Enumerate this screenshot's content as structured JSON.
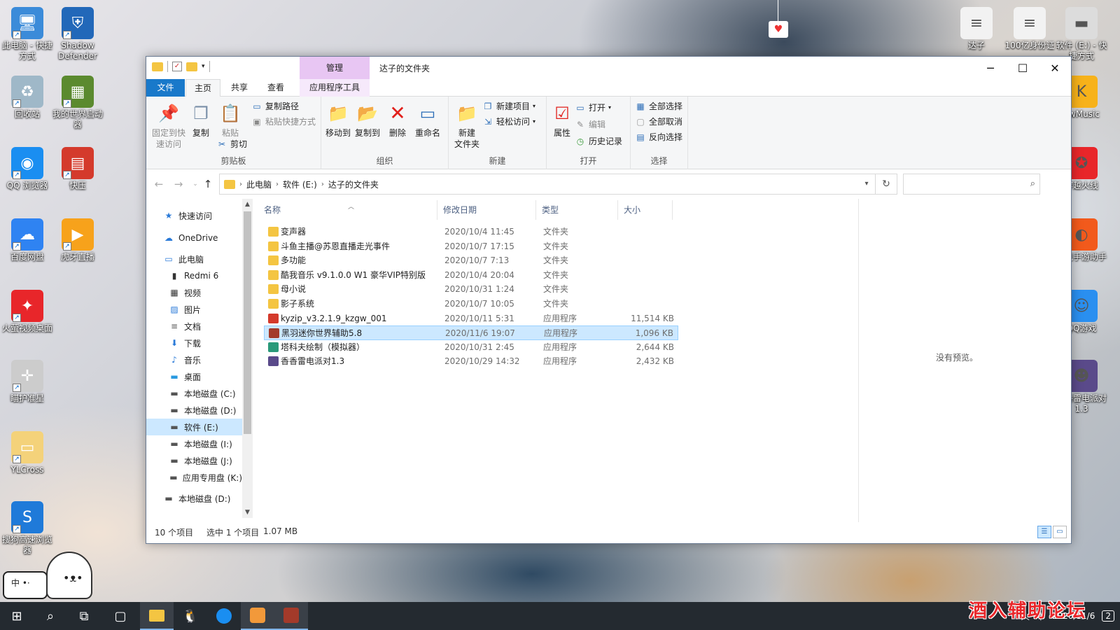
{
  "desktop": {
    "left_icons": [
      {
        "label": "此电脑 - 快捷方式",
        "icon": "computer-icon",
        "color": "#3b8bd9"
      },
      {
        "label": "Shadow Defender",
        "icon": "shield-icon",
        "color": "#2268b9"
      },
      {
        "label": "回收站",
        "icon": "recycle-bin-icon",
        "color": "#9fb8c8"
      },
      {
        "label": "我的世界启动器",
        "icon": "minecraft-icon",
        "color": "#5b8a2f"
      },
      {
        "label": "QQ 浏览器",
        "icon": "qq-browser-icon",
        "color": "#1a8ef1"
      },
      {
        "label": "快压",
        "icon": "archive-icon",
        "color": "#d43a2c"
      },
      {
        "label": "百度网盘",
        "icon": "baidu-netdisk-icon",
        "color": "#2f83f2"
      },
      {
        "label": "虎牙直播",
        "icon": "huya-icon",
        "color": "#f7a21b"
      },
      {
        "label": "火萤视频桌面",
        "icon": "firefly-icon",
        "color": "#e8262a"
      },
      {
        "label": "瞄护准星",
        "icon": "crosshair-icon",
        "color": "#cccccc"
      },
      {
        "label": "YLCross",
        "icon": "folder-icon",
        "color": "#f4d27a"
      },
      {
        "label": "搜狗高速浏览器",
        "icon": "sogou-icon",
        "color": "#1f7ad9"
      }
    ],
    "right_icons": [
      {
        "label": "达子",
        "icon": "document-icon",
        "color": "#f2f2f2"
      },
      {
        "label": "100亿身份证",
        "icon": "document-icon",
        "color": "#f2f2f2"
      },
      {
        "label": "软件 (E:) - 快捷方式",
        "icon": "drive-icon",
        "color": "#dcdcdc"
      },
      {
        "label": "KwMusic",
        "icon": "kwmusic-icon",
        "color": "#f7b21a"
      },
      {
        "label": "穿越火线",
        "icon": "crossfire-icon",
        "color": "#e8262a"
      },
      {
        "label": "腾讯手游助手",
        "icon": "game-helper-icon",
        "color": "#f25a1c"
      },
      {
        "label": "QQ游戏",
        "icon": "qq-game-icon",
        "color": "#2a8ff0"
      },
      {
        "label": "香香雷电派对1.3",
        "icon": "game-icon",
        "color": "#5a4a8a"
      }
    ]
  },
  "window": {
    "title": "达子的文件夹",
    "context_tab": "管理",
    "controls": {
      "minimize": "─",
      "maximize": "☐",
      "close": "✕"
    }
  },
  "tabs": [
    "文件",
    "主页",
    "共享",
    "查看",
    "应用程序工具"
  ],
  "ribbon": {
    "clipboard": {
      "label": "剪贴板",
      "pin": "固定到快速访问",
      "copy": "复制",
      "paste": "粘贴",
      "copy_path": "复制路径",
      "paste_shortcut": "粘贴快捷方式",
      "cut": "剪切"
    },
    "organize": {
      "label": "组织",
      "move_to": "移动到",
      "copy_to": "复制到",
      "delete": "删除",
      "rename": "重命名"
    },
    "new": {
      "label": "新建",
      "new_folder": "新建\n文件夹",
      "new_item": "新建项目",
      "easy_access": "轻松访问"
    },
    "open": {
      "label": "打开",
      "properties": "属性",
      "open": "打开",
      "edit": "编辑",
      "history": "历史记录"
    },
    "select": {
      "label": "选择",
      "select_all": "全部选择",
      "select_none": "全部取消",
      "invert": "反向选择"
    }
  },
  "address": {
    "crumbs": [
      "此电脑",
      "软件 (E:)",
      "达子的文件夹"
    ],
    "search_placeholder": ""
  },
  "nav": [
    {
      "label": "快速访问",
      "icon": "star-icon",
      "indent": 1
    },
    {
      "label": "OneDrive",
      "icon": "cloud-icon",
      "indent": 1
    },
    {
      "label": "此电脑",
      "icon": "computer-icon",
      "indent": 1
    },
    {
      "label": "Redmi 6",
      "icon": "phone-icon",
      "indent": 2
    },
    {
      "label": "视频",
      "icon": "video-icon",
      "indent": 2
    },
    {
      "label": "图片",
      "icon": "picture-icon",
      "indent": 2
    },
    {
      "label": "文档",
      "icon": "document-icon",
      "indent": 2
    },
    {
      "label": "下载",
      "icon": "download-icon",
      "indent": 2
    },
    {
      "label": "音乐",
      "icon": "music-icon",
      "indent": 2
    },
    {
      "label": "桌面",
      "icon": "desktop-icon",
      "indent": 2
    },
    {
      "label": "本地磁盘 (C:)",
      "icon": "drive-icon",
      "indent": 2
    },
    {
      "label": "本地磁盘 (D:)",
      "icon": "drive-icon",
      "indent": 2
    },
    {
      "label": "软件 (E:)",
      "icon": "drive-icon",
      "indent": 2,
      "selected": true
    },
    {
      "label": "本地磁盘 (I:)",
      "icon": "drive-icon",
      "indent": 2
    },
    {
      "label": "本地磁盘 (J:)",
      "icon": "drive-icon",
      "indent": 2
    },
    {
      "label": "应用专用盘 (K:)",
      "icon": "drive-icon",
      "indent": 2
    },
    {
      "label": "本地磁盘 (D:)",
      "icon": "drive-icon",
      "indent": 1
    }
  ],
  "columns": [
    "名称",
    "修改日期",
    "类型",
    "大小"
  ],
  "files": [
    {
      "name": "变声器",
      "date": "2020/10/4 11:45",
      "type": "文件夹",
      "size": "",
      "icon": "folder-icon",
      "color": "#f4c542"
    },
    {
      "name": "斗鱼主播@苏恩直播走光事件",
      "date": "2020/10/7 17:15",
      "type": "文件夹",
      "size": "",
      "icon": "folder-icon",
      "color": "#f4c542"
    },
    {
      "name": "多功能",
      "date": "2020/10/7 7:13",
      "type": "文件夹",
      "size": "",
      "icon": "folder-icon",
      "color": "#f4c542"
    },
    {
      "name": "酷我音乐 v9.1.0.0 W1 豪华VIP特别版",
      "date": "2020/10/4 20:04",
      "type": "文件夹",
      "size": "",
      "icon": "folder-icon",
      "color": "#f4c542"
    },
    {
      "name": "母小说",
      "date": "2020/10/31 1:24",
      "type": "文件夹",
      "size": "",
      "icon": "folder-icon",
      "color": "#f4c542"
    },
    {
      "name": "影子系统",
      "date": "2020/10/7 10:05",
      "type": "文件夹",
      "size": "",
      "icon": "folder-icon",
      "color": "#f4c542"
    },
    {
      "name": "kyzip_v3.2.1.9_kzgw_001",
      "date": "2020/10/11 5:31",
      "type": "应用程序",
      "size": "11,514 KB",
      "icon": "kyzip-icon",
      "color": "#d43a2c"
    },
    {
      "name": "黑羽迷你世界辅助5.8",
      "date": "2020/11/6 19:07",
      "type": "应用程序",
      "size": "1,096 KB",
      "icon": "app-icon",
      "color": "#a33a2a",
      "selected": true
    },
    {
      "name": "塔科夫绘制（模拟器）",
      "date": "2020/10/31 2:45",
      "type": "应用程序",
      "size": "2,644 KB",
      "icon": "app-icon",
      "color": "#2a9a7a"
    },
    {
      "name": "香香雷电派对1.3",
      "date": "2020/10/29 14:32",
      "type": "应用程序",
      "size": "2,432 KB",
      "icon": "app-icon",
      "color": "#5a4a8a"
    }
  ],
  "preview": "没有预览。",
  "status": {
    "count": "10 个项目",
    "selected": "选中 1 个项目",
    "size": "1.07 MB"
  },
  "taskbar": {
    "clock_time": "",
    "clock_date": "2020/11/6",
    "ime": "中",
    "tray_badge": "2"
  },
  "watermark": "酒入辅助论坛",
  "colors": {
    "accent": "#1979ca",
    "selection": "#cce8ff",
    "context_tab": "#e8c6f3"
  }
}
